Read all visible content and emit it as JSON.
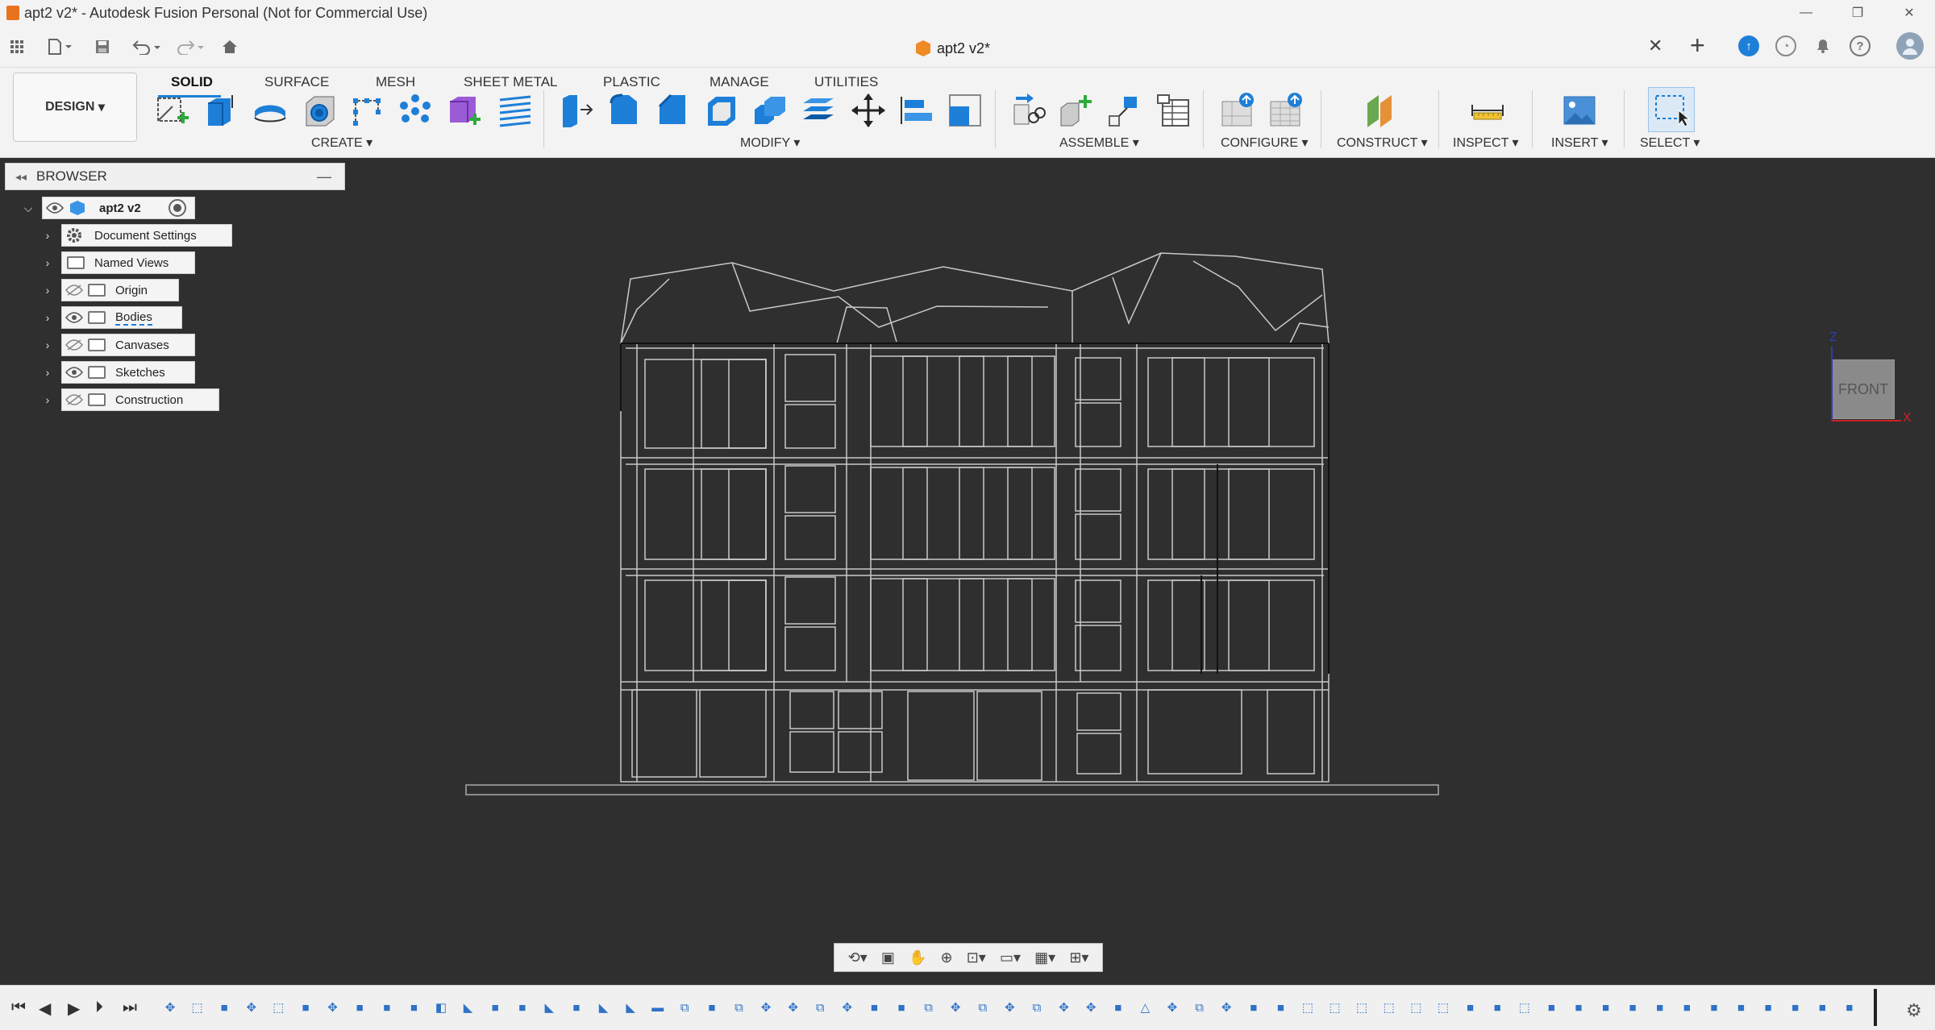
{
  "window": {
    "title": "apt2 v2* - Autodesk Fusion Personal (Not for Commercial Use)",
    "minimize": "—",
    "restore": "❐",
    "close": "✕"
  },
  "tabs": {
    "document_title": "apt2 v2*",
    "close": "✕",
    "new_tab": "+"
  },
  "toolbar": {
    "workspace": "DESIGN",
    "tabs": [
      "SOLID",
      "SURFACE",
      "MESH",
      "SHEET METAL",
      "PLASTIC",
      "MANAGE",
      "UTILITIES"
    ],
    "active_tab": "SOLID",
    "groups": [
      "CREATE",
      "MODIFY",
      "ASSEMBLE",
      "CONFIGURE",
      "CONSTRUCT",
      "INSPECT",
      "INSERT",
      "SELECT"
    ],
    "accent": "#1e7fd8"
  },
  "browser": {
    "title": "BROWSER",
    "root": "apt2 v2",
    "items": [
      {
        "label": "Document Settings",
        "icon": "gear-icon"
      },
      {
        "label": "Named Views",
        "icon": "folder-icon"
      },
      {
        "label": "Origin",
        "icon": "folder-icon",
        "visibility": "hidden"
      },
      {
        "label": "Bodies",
        "icon": "folder-icon",
        "visibility": "visible"
      },
      {
        "label": "Canvases",
        "icon": "folder-icon",
        "visibility": "hidden"
      },
      {
        "label": "Sketches",
        "icon": "folder-icon",
        "visibility": "visible"
      },
      {
        "label": "Construction",
        "icon": "folder-icon",
        "visibility": "hidden"
      }
    ]
  },
  "viewcube": {
    "face": "FRONT",
    "axis_z": "Z",
    "axis_x": "X"
  },
  "colors": {
    "viewport_bg": "#2f2f2f",
    "model_lines": "#c9c9c9",
    "panel_bg": "#f3f3f3"
  }
}
